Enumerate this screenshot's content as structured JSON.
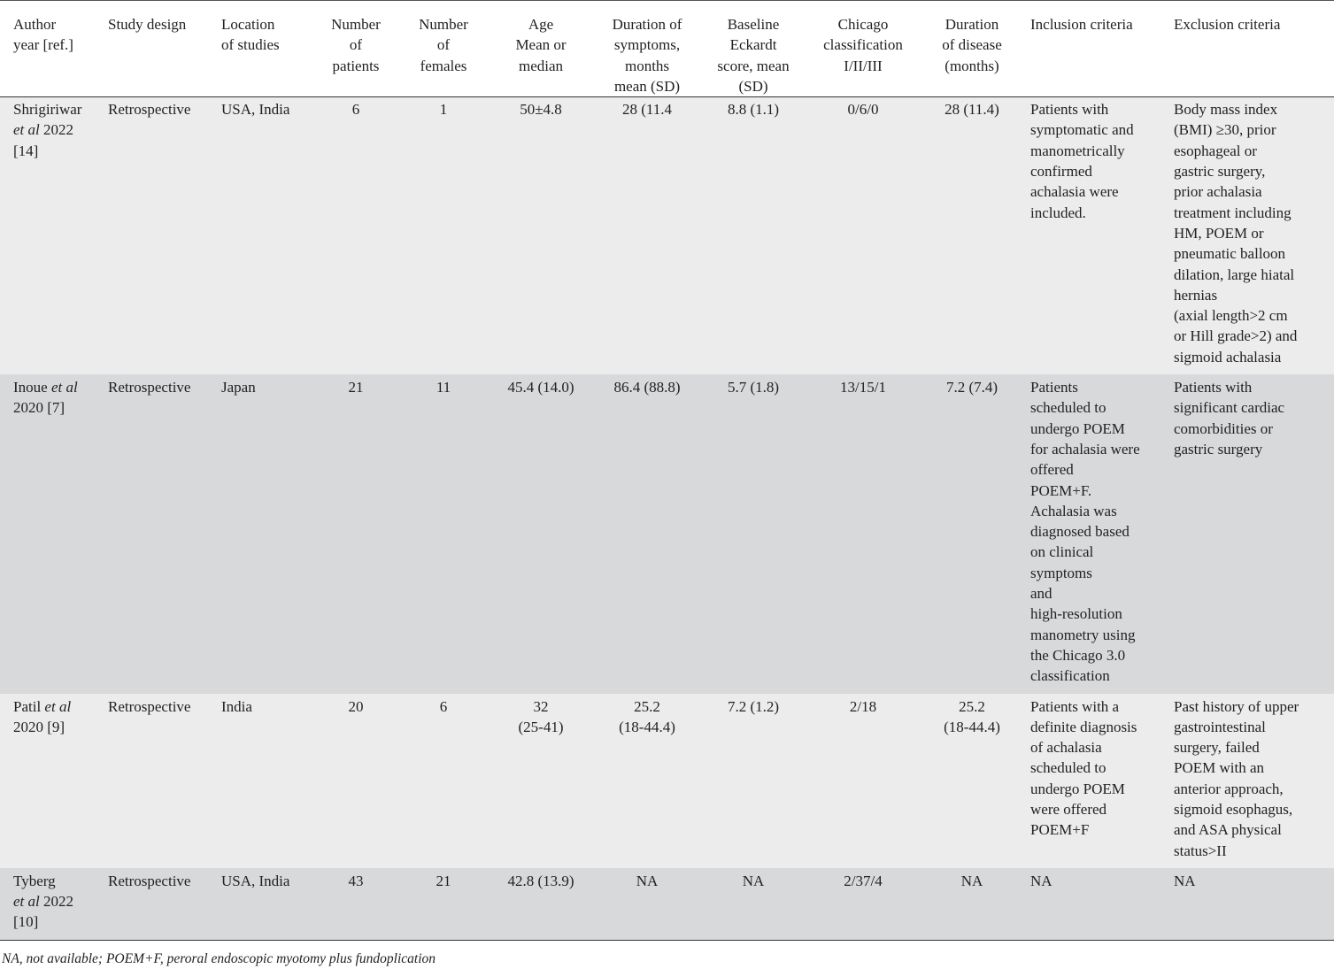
{
  "table": {
    "headers": [
      "Author\nyear [ref.]",
      "Study design",
      "Location\nof studies",
      "Number\nof\npatients",
      "Number\nof\nfemales",
      "Age\nMean or\nmedian",
      "Duration of\nsymptoms,\nmonths\nmean (SD)",
      "Baseline\nEckardt\nscore, mean\n(SD)",
      "Chicago\nclassification\nI/II/III",
      "Duration\nof disease\n(months)",
      "Inclusion criteria",
      "Exclusion criteria"
    ],
    "rows": [
      {
        "author_pre": "Shrigiriwar",
        "author_etal": "et al",
        "author_post": " 2022\n[14]",
        "design": "Retrospective",
        "location": "USA, India",
        "patients": "6",
        "females": "1",
        "age": "50±4.8",
        "symptoms": "28 (11.4",
        "eckardt": "8.8 (1.1)",
        "chicago": "0/6/0",
        "disease": "28 (11.4)",
        "inclusion": "Patients with\nsymptomatic and\nmanometrically\nconfirmed\nachalasia were\nincluded.",
        "exclusion": "Body mass index\n(BMI) ≥30, prior\nesophageal or\ngastric surgery,\nprior achalasia\ntreatment including\nHM, POEM or\npneumatic balloon\ndilation, large hiatal\nhernias\n(axial length>2 cm\nor Hill grade>2) and\nsigmoid achalasia"
      },
      {
        "author_pre": "Inoue ",
        "author_etal": "et al",
        "author_post": "\n2020 [7]",
        "design": "Retrospective",
        "location": "Japan",
        "patients": "21",
        "females": "11",
        "age": "45.4 (14.0)",
        "symptoms": "86.4 (88.8)",
        "eckardt": "5.7 (1.8)",
        "chicago": "13/15/1",
        "disease": "7.2 (7.4)",
        "inclusion": "Patients\nscheduled to\nundergo POEM\nfor achalasia were\noffered\nPOEM+F.\nAchalasia was\ndiagnosed based\non clinical\nsymptoms\nand\nhigh-resolution\nmanometry using\nthe Chicago 3.0\nclassification",
        "exclusion": "Patients with\nsignificant cardiac\ncomorbidities or\ngastric surgery"
      },
      {
        "author_pre": "Patil ",
        "author_etal": "et al",
        "author_post": "\n2020 [9]",
        "design": "Retrospective",
        "location": "India",
        "patients": "20",
        "females": "6",
        "age": "32\n(25-41)",
        "symptoms": "25.2\n(18-44.4)",
        "eckardt": "7.2 (1.2)",
        "chicago": "2/18",
        "disease": "25.2\n(18-44.4)",
        "inclusion": "Patients with a\ndefinite diagnosis\nof achalasia\nscheduled to\nundergo POEM\nwere offered\nPOEM+F",
        "exclusion": "Past history of upper\ngastrointestinal\nsurgery, failed\nPOEM with an\nanterior approach,\nsigmoid esophagus,\nand ASA physical\nstatus>II"
      },
      {
        "author_pre": "Tyberg\n",
        "author_etal": "et al",
        "author_post": " 2022\n[10]",
        "design": "Retrospective",
        "location": "USA, India",
        "patients": "43",
        "females": "21",
        "age": "42.8 (13.9)",
        "symptoms": "NA",
        "eckardt": "NA",
        "chicago": "2/37/4",
        "disease": "NA",
        "inclusion": "NA",
        "exclusion": "NA"
      }
    ]
  },
  "footnote": "NA, not available; POEM+F, peroral endoscopic myotomy plus fundoplication"
}
